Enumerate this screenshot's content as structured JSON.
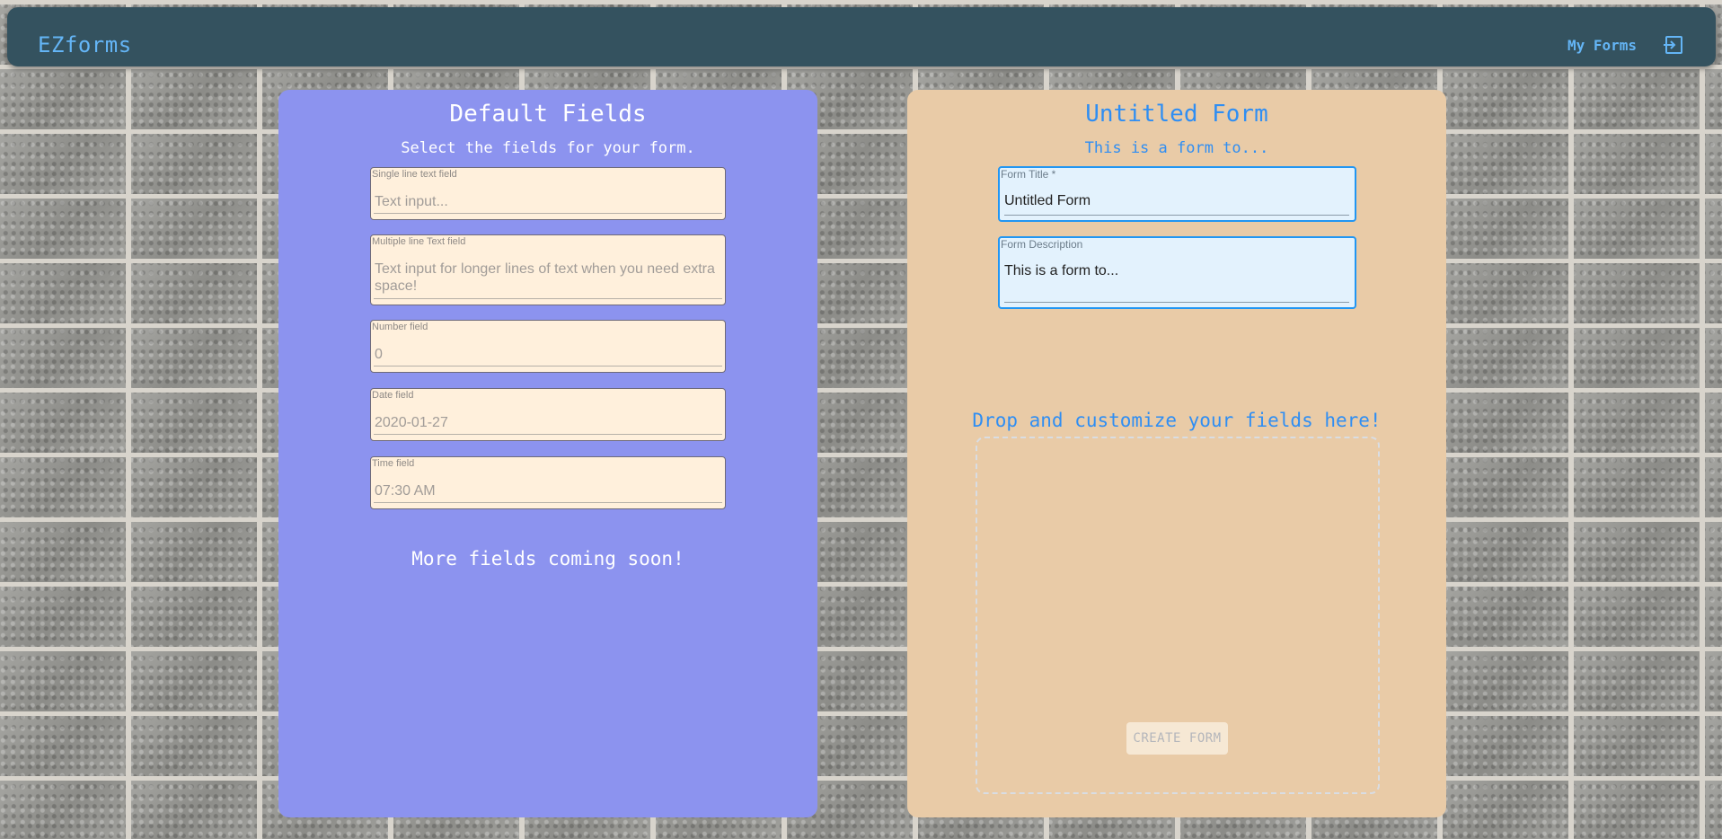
{
  "header": {
    "brand": "EZforms",
    "my_forms_label": "My Forms",
    "logout_icon": "logout-icon"
  },
  "left_panel": {
    "title": "Default Fields",
    "subtitle": "Select the fields for your form.",
    "fields": [
      {
        "label": "Single line text field",
        "value": "Text input..."
      },
      {
        "label": "Multiple line Text field",
        "value": "Text input for longer lines of text when you need extra space!"
      },
      {
        "label": "Number field",
        "value": "0"
      },
      {
        "label": "Date field",
        "value": "2020-01-27"
      },
      {
        "label": "Time field",
        "value": "07:30 AM"
      }
    ],
    "footer_note": "More fields coming soon!"
  },
  "right_panel": {
    "title": "Untitled Form",
    "subtitle": "This is a form to...",
    "form_title": {
      "label": "Form Title *",
      "value": "Untitled Form"
    },
    "form_description": {
      "label": "Form Description",
      "value": "This is a form to..."
    },
    "drop_title": "Drop and customize your fields here!",
    "create_button": "CREATE FORM"
  },
  "colors": {
    "header_bg": "#34525f",
    "accent_blue": "#64b5f6",
    "left_panel_bg": "#8c93ef",
    "right_panel_bg": "#e9cba7",
    "field_bg": "#fff0dc",
    "input_focus": "#2196f3"
  }
}
